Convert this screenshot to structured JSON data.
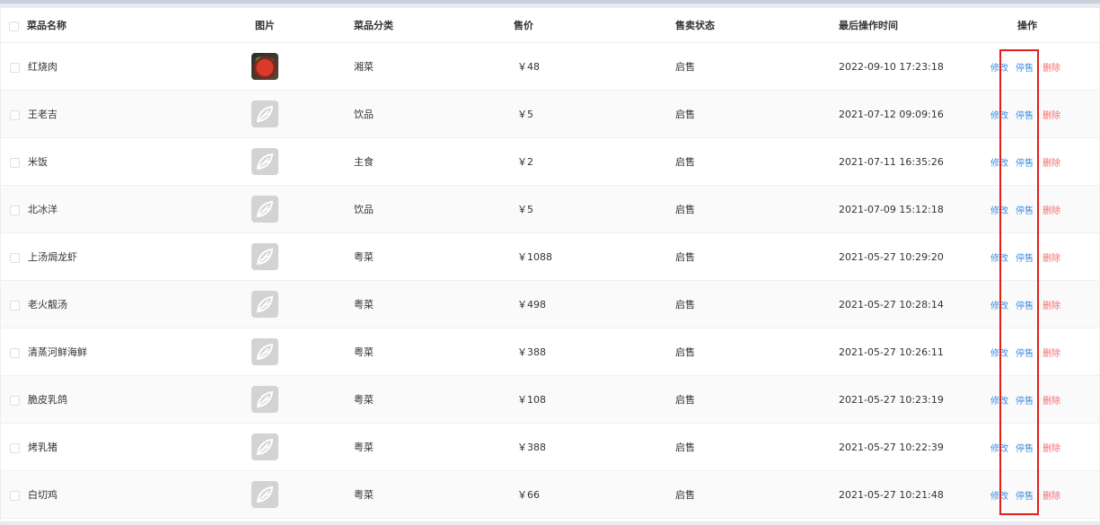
{
  "columns": {
    "name": "菜品名称",
    "image": "图片",
    "category": "菜品分类",
    "price": "售价",
    "status": "售卖状态",
    "time": "最后操作时间",
    "ops": "操作"
  },
  "actions": {
    "edit": "修改",
    "stop": "停售",
    "delete": "删除"
  },
  "highlight_color": "#e0201c",
  "rows": [
    {
      "name": "红烧肉",
      "image": "photo",
      "category": "湘菜",
      "price": "￥48",
      "status": "启售",
      "time": "2022-09-10 17:23:18"
    },
    {
      "name": "王老吉",
      "image": "placeholder",
      "category": "饮品",
      "price": "￥5",
      "status": "启售",
      "time": "2021-07-12 09:09:16"
    },
    {
      "name": "米饭",
      "image": "placeholder",
      "category": "主食",
      "price": "￥2",
      "status": "启售",
      "time": "2021-07-11 16:35:26"
    },
    {
      "name": "北冰洋",
      "image": "placeholder",
      "category": "饮品",
      "price": "￥5",
      "status": "启售",
      "time": "2021-07-09 15:12:18"
    },
    {
      "name": "上汤焗龙虾",
      "image": "placeholder",
      "category": "粤菜",
      "price": "￥1088",
      "status": "启售",
      "time": "2021-05-27 10:29:20"
    },
    {
      "name": "老火靓汤",
      "image": "placeholder",
      "category": "粤菜",
      "price": "￥498",
      "status": "启售",
      "time": "2021-05-27 10:28:14"
    },
    {
      "name": "清蒸河鲜海鲜",
      "image": "placeholder",
      "category": "粤菜",
      "price": "￥388",
      "status": "启售",
      "time": "2021-05-27 10:26:11"
    },
    {
      "name": "脆皮乳鸽",
      "image": "placeholder",
      "category": "粤菜",
      "price": "￥108",
      "status": "启售",
      "time": "2021-05-27 10:23:19"
    },
    {
      "name": "烤乳猪",
      "image": "placeholder",
      "category": "粤菜",
      "price": "￥388",
      "status": "启售",
      "time": "2021-05-27 10:22:39"
    },
    {
      "name": "白切鸡",
      "image": "placeholder",
      "category": "粤菜",
      "price": "￥66",
      "status": "启售",
      "time": "2021-05-27 10:21:48"
    }
  ]
}
